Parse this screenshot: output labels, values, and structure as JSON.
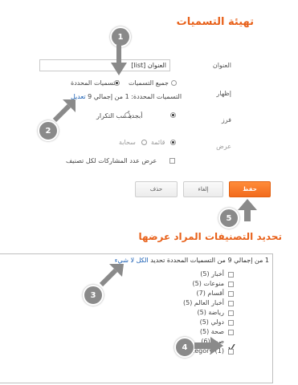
{
  "header": {
    "title": "تهيئة التسميات"
  },
  "form": {
    "title_label": "العنوان",
    "title_value": "العنوان [list]",
    "display_label": "إظهار",
    "display_all": "جميع التسميات",
    "display_selected": "التسميات المحددة",
    "selected_summary_prefix": "التسميات المحددة: 1 من إجمالي 9",
    "selected_summary_link": "تعديل",
    "sort_label": "فرز",
    "sort_alpha": "أبجدياً",
    "sort_freq": "حسب التكرار",
    "view_label": "عرض",
    "view_list": "قائمة",
    "view_cloud": "سحابة",
    "show_count_label": "عرض عدد المشاركات لكل تصنيف"
  },
  "buttons": {
    "save": "حفظ",
    "cancel": "إلغاء",
    "delete": "حذف"
  },
  "section2": {
    "title": "تحديد التصنيفات المراد عرضها",
    "summary": "1 من إجمالي 9 من التسميات المحددة",
    "select": "تحديد",
    "all": "الكل",
    "none": "لا شيء"
  },
  "categories": [
    {
      "label": "أخبار (5)",
      "checked": false
    },
    {
      "label": "منوعات (5)",
      "checked": false
    },
    {
      "label": "أقسام (7)",
      "checked": false
    },
    {
      "label": "أخبار العالم (5)",
      "checked": false
    },
    {
      "label": "رياضة (5)",
      "checked": false
    },
    {
      "label": "دولي (5)",
      "checked": false
    },
    {
      "label": "صحة (5)",
      "checked": false
    },
    {
      "label": "صور (6)",
      "checked": true
    },
    {
      "label": "category (1)",
      "checked": false
    }
  ],
  "annotations": [
    "1",
    "2",
    "3",
    "4",
    "5"
  ],
  "colors": {
    "accent": "#e8611a",
    "badge": "#8a8a8a",
    "link": "#1a5fb4"
  }
}
